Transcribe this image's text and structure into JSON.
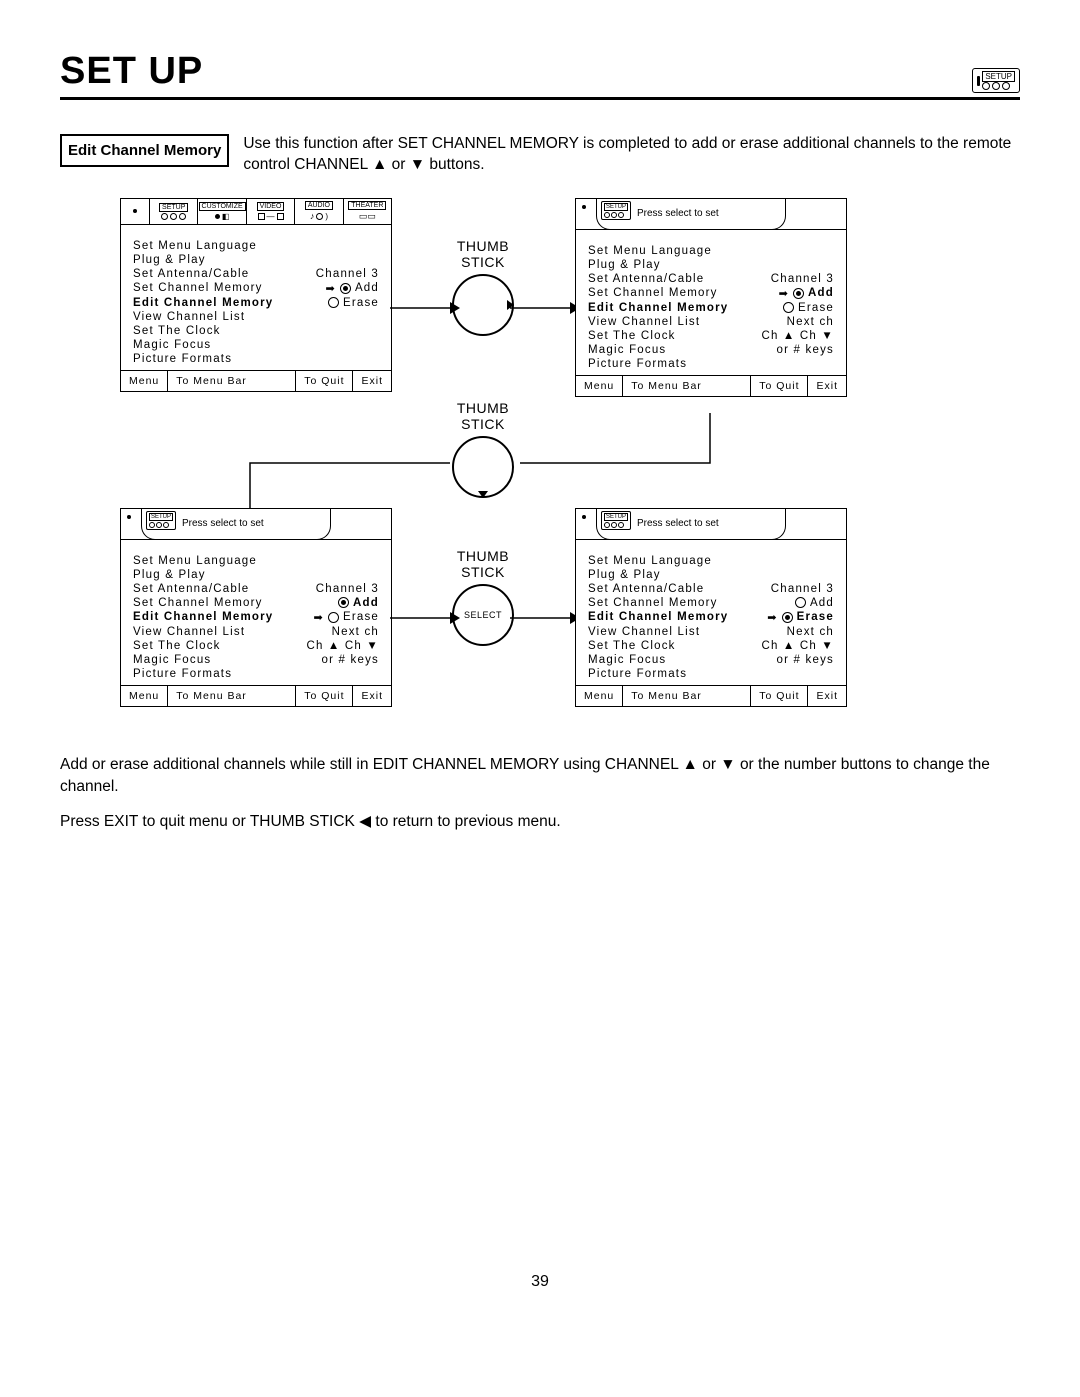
{
  "page": {
    "title": "SET UP",
    "number": "39"
  },
  "section": {
    "label": "Edit Channel Memory",
    "intro": "Use this function after SET CHANNEL MEMORY is completed to add or erase additional channels to the remote control CHANNEL ▲ or ▼ buttons."
  },
  "footer_text": {
    "line1": "Add or erase additional channels while still in EDIT CHANNEL MEMORY using CHANNEL ▲ or ▼ or the number buttons to change the channel.",
    "line2": "Press EXIT to quit menu or THUMB STICK ◀ to return to previous menu."
  },
  "thumbstick": {
    "label_line1": "THUMB",
    "label_line2": "STICK",
    "select": "SELECT"
  },
  "tabs": {
    "setup": "SETUP",
    "customize": "CUSTOMIZE",
    "video": "VIDEO",
    "audio": "AUDIO",
    "theater": "THEATER"
  },
  "subhead": {
    "press_select": "Press select to set"
  },
  "menu_items": {
    "set_menu_language": "Set Menu Language",
    "plug_and_play": "Plug & Play",
    "set_antenna_cable": "Set Antenna/Cable",
    "set_channel_memory": "Set Channel Memory",
    "edit_channel_memory": "Edit Channel Memory",
    "view_channel_list": "View Channel List",
    "set_the_clock": "Set The Clock",
    "magic_focus": "Magic Focus",
    "picture_formats": "Picture Formats"
  },
  "values": {
    "channel3": "Channel 3",
    "add": "Add",
    "erase": "Erase",
    "next_ch": "Next ch",
    "ch_up_down": "Ch ▲ Ch ▼",
    "or_num_keys": "or # keys"
  },
  "footer_labels": {
    "menu": "Menu",
    "to_menu_bar": "To Menu Bar",
    "to_quit": "To Quit",
    "exit": "Exit"
  }
}
